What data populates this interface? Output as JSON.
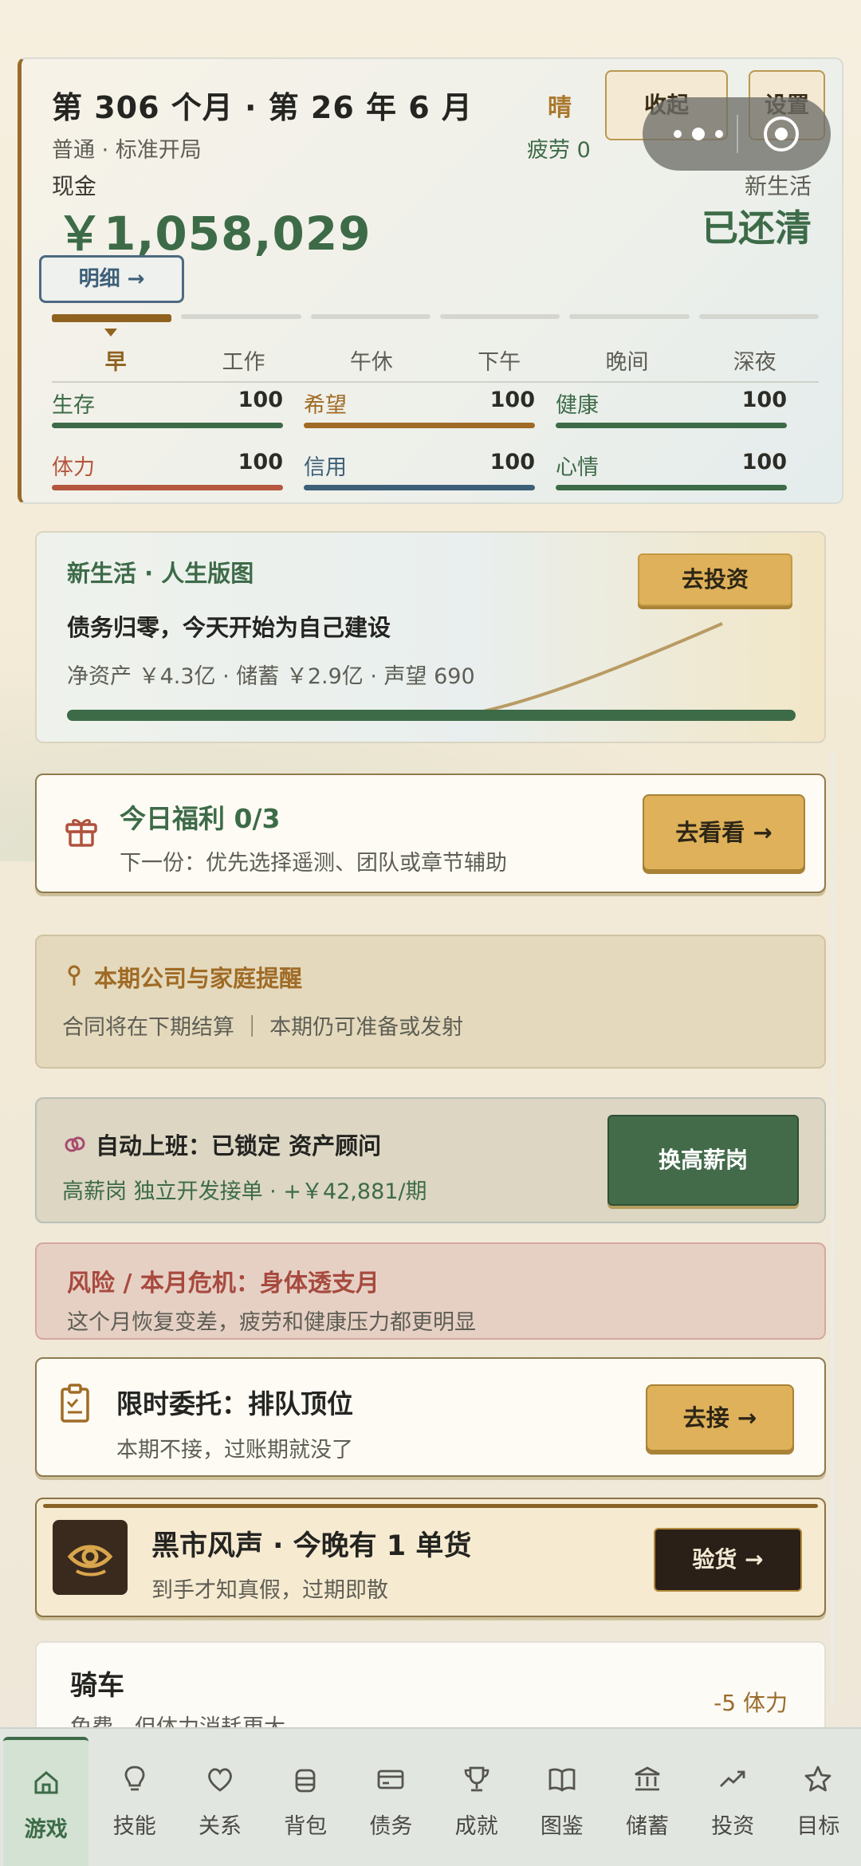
{
  "status": {
    "title": "第 306 个月 · 第 26 年 6 月",
    "subtitle": "普通 · 标准开局",
    "weather": "晴",
    "fatigue": "疲劳 0",
    "collapse_label": "收起",
    "settings_label": "设置",
    "cash_label": "现金",
    "cash_value": "￥1,058,029",
    "stage_label": "新生活",
    "stage_value": "已还清",
    "detail_label": "明细 →",
    "time_slots": [
      "早",
      "工作",
      "午休",
      "下午",
      "晚间",
      "深夜"
    ],
    "active_slot": 0,
    "stats": [
      {
        "label": "生存",
        "value": "100",
        "color": "#3d6b48"
      },
      {
        "label": "希望",
        "value": "100",
        "color": "#a06b26"
      },
      {
        "label": "健康",
        "value": "100",
        "color": "#3d6b48"
      },
      {
        "label": "体力",
        "value": "100",
        "color": "#b5563e"
      },
      {
        "label": "信用",
        "value": "100",
        "color": "#3d5f78"
      },
      {
        "label": "心情",
        "value": "100",
        "color": "#3d6b48"
      }
    ]
  },
  "life": {
    "title": "新生活 · 人生版图",
    "headline": "债务归零，今天开始为自己建设",
    "stats": "净资产 ￥4.3亿 · 储蓄 ￥2.9亿 · 声望 690",
    "invest_label": "去投资"
  },
  "welfare": {
    "title": "今日福利 0/3",
    "subtitle": "下一份：优先选择遥测、团队或章节辅助",
    "button_label": "去看看 →"
  },
  "reminder": {
    "title": "本期公司与家庭提醒",
    "subtitle": "合同将在下期结算 ｜ 本期仍可准备或发射"
  },
  "work": {
    "title": "自动上班：已锁定 资产顾问",
    "subtitle": "高薪岗 独立开发接单 · +￥42,881/期",
    "button_label": "换高薪岗"
  },
  "risk": {
    "title": "风险 / 本月危机：身体透支月",
    "subtitle": "这个月恢复变差，疲劳和健康压力都更明显"
  },
  "task": {
    "title": "限时委托：排队顶位",
    "subtitle": "本期不接，过账期就没了",
    "button_label": "去接 →"
  },
  "black_market": {
    "title": "黑市风声 · 今晚有 1 单货",
    "subtitle": "到手才知真假，过期即散",
    "button_label": "验货 →"
  },
  "travel": {
    "title": "骑车",
    "subtitle": "免费，但体力消耗更大",
    "cost": "-5 体力"
  },
  "nav": [
    {
      "label": "游戏",
      "icon": "home-icon",
      "active": true
    },
    {
      "label": "技能",
      "icon": "lightbulb-icon"
    },
    {
      "label": "关系",
      "icon": "heart-icon"
    },
    {
      "label": "背包",
      "icon": "backpack-icon"
    },
    {
      "label": "债务",
      "icon": "card-icon"
    },
    {
      "label": "成就",
      "icon": "trophy-icon"
    },
    {
      "label": "图鉴",
      "icon": "book-icon"
    },
    {
      "label": "储蓄",
      "icon": "bank-icon"
    },
    {
      "label": "投资",
      "icon": "trend-icon"
    },
    {
      "label": "目标",
      "icon": "star-icon"
    }
  ],
  "colors": {
    "accent_green": "#3d6b48",
    "accent_gold": "#deb15a",
    "accent_brown": "#8f6220",
    "risk_red": "#a84a3f"
  }
}
